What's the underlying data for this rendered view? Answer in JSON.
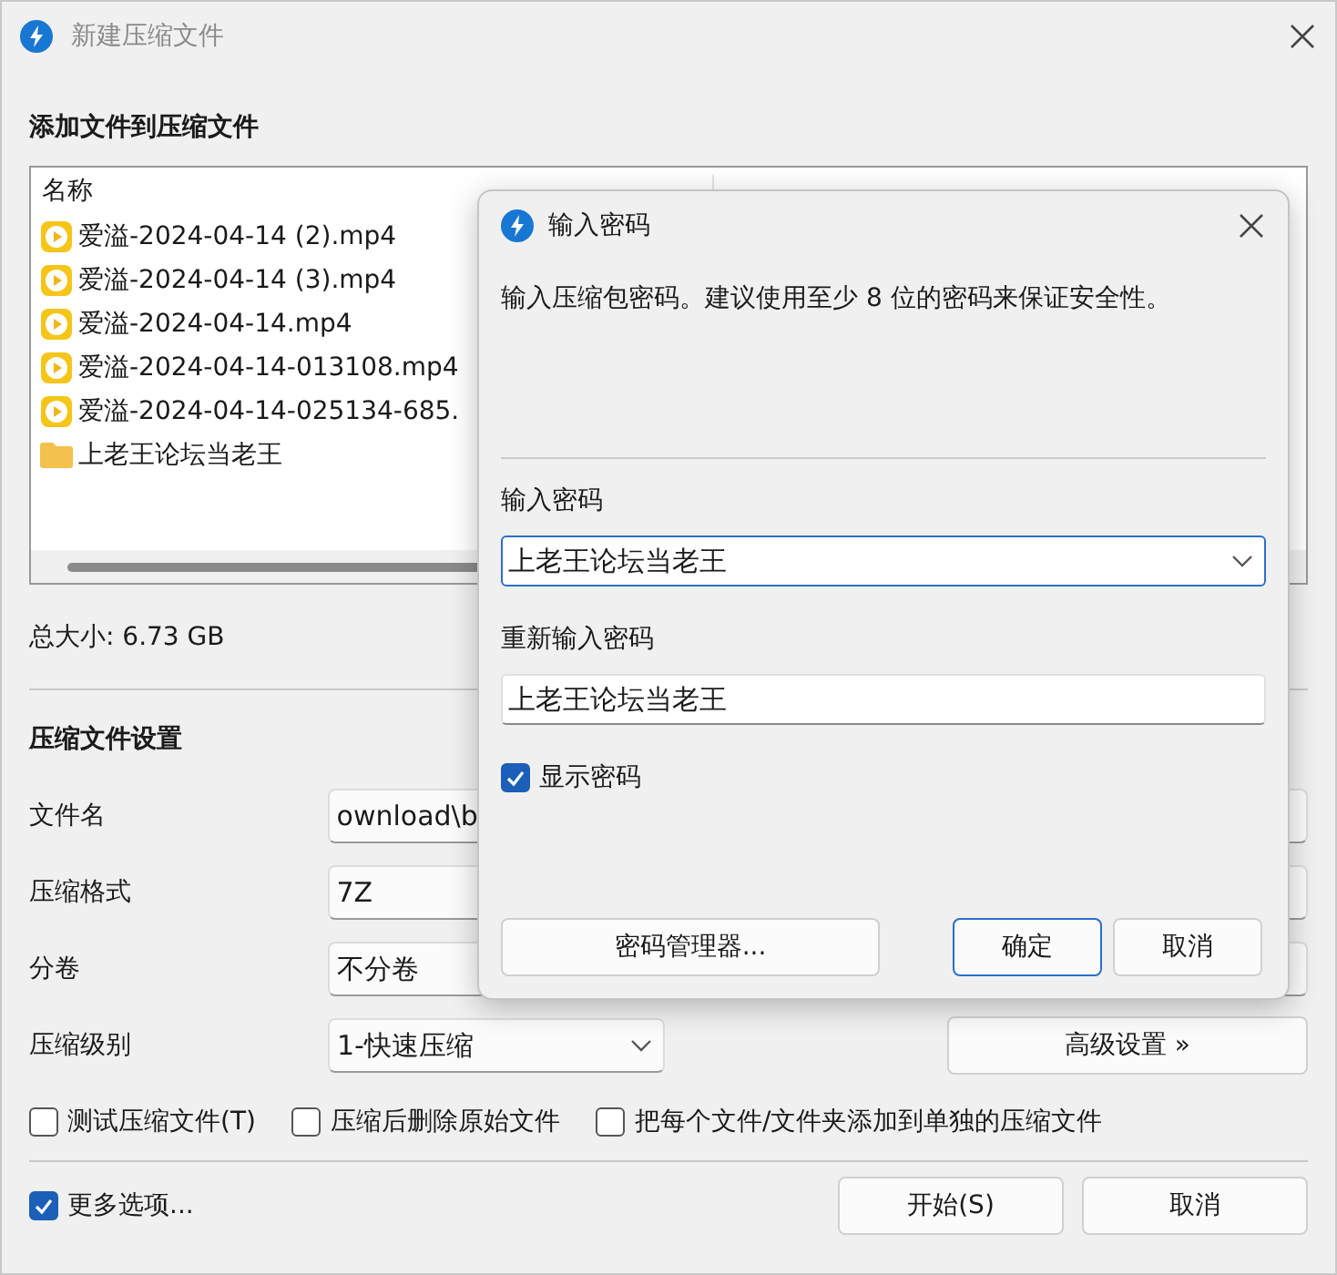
{
  "window": {
    "title": "新建压缩文件",
    "active": false
  },
  "add_section": {
    "heading": "添加文件到压缩文件"
  },
  "file_list": {
    "columns": [
      "名称"
    ],
    "rows": [
      {
        "kind": "video",
        "name": "爱溢-2024-04-14 (2).mp4"
      },
      {
        "kind": "video",
        "name": "爱溢-2024-04-14 (3).mp4"
      },
      {
        "kind": "video",
        "name": "爱溢-2024-04-14.mp4"
      },
      {
        "kind": "video",
        "name": "爱溢-2024-04-14-013108.mp4"
      },
      {
        "kind": "video",
        "name": "爱溢-2024-04-14-025134-685."
      },
      {
        "kind": "folder",
        "name": "上老王论坛当老王"
      }
    ]
  },
  "total_size": "总大小: 6.73 GB",
  "settings": {
    "heading": "压缩文件设置",
    "fields": [
      {
        "kind": "input",
        "label": "文件名",
        "value": "ownload\\b"
      },
      {
        "kind": "select",
        "label": "压缩格式",
        "value": "7Z"
      },
      {
        "kind": "select",
        "label": "分卷",
        "value": "不分卷"
      },
      {
        "kind": "dropdown",
        "label": "压缩级别",
        "value": "1-快速压缩"
      }
    ],
    "advanced_button": "高级设置 »",
    "options": [
      {
        "label": "测试压缩文件(T)",
        "checked": false
      },
      {
        "label": "压缩后删除原始文件",
        "checked": false
      },
      {
        "label": "把每个文件/文件夹添加到单独的压缩文件",
        "checked": false
      }
    ]
  },
  "footer": {
    "more_options": {
      "label": "更多选项...",
      "checked": true
    },
    "buttons": [
      "开始(S)",
      "取消"
    ]
  },
  "password_dialog": {
    "title": "输入密码",
    "description": "输入压缩包密码。建议使用至少 8 位的密码来保证安全性。",
    "password_label": "输入密码",
    "password_value": "上老王论坛当老王",
    "confirm_label": "重新输入密码",
    "confirm_value": "上老王论坛当老王",
    "show_password": {
      "label": "显示密码",
      "checked": true
    },
    "buttons": [
      {
        "label": "密码管理器...",
        "default": false
      },
      {
        "label": "确定",
        "default": true
      },
      {
        "label": "取消",
        "default": false
      }
    ]
  }
}
